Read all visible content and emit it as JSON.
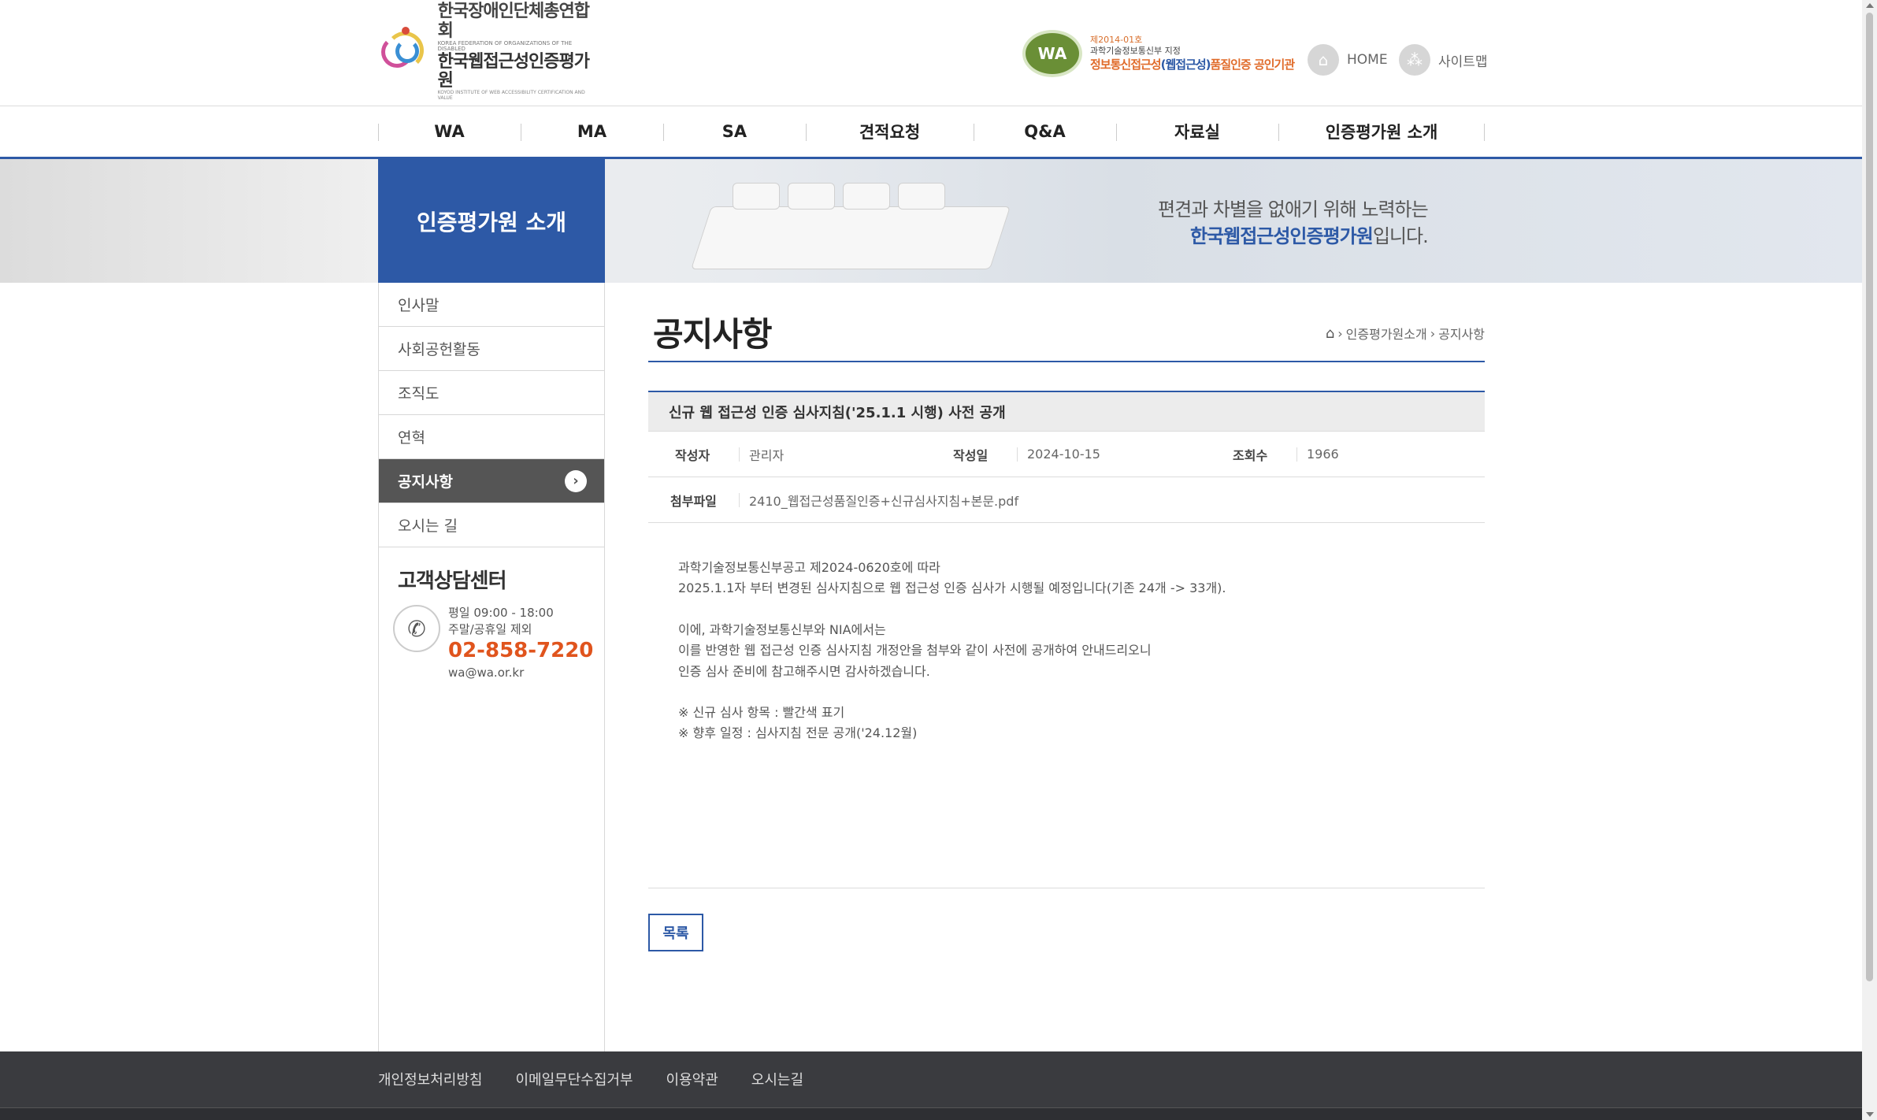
{
  "header": {
    "logo_line1": "한국장애인단체총연합회",
    "logo_line1_sub": "KOREA FEDERATION OF ORGANIZATIONS OF THE DISABLED",
    "logo_line2": "한국웹접근성인증평가원",
    "logo_line2_sub": "KOYOD INSTITUTE OF WEB ACCESSIBILITY CERTIFICATION AND VALUE",
    "cert_badge": "WA",
    "cert_no": "제2014-01호",
    "cert_line2": "과학기술정보통신부 지정",
    "cert_line3a": "정보통신접근성",
    "cert_line3b": "(웹접근성)",
    "cert_line3c": "품질인증 공인기관",
    "home_label": "HOME",
    "sitemap_label": "사이트맵"
  },
  "gnb": {
    "items": [
      "WA",
      "MA",
      "SA",
      "견적요청",
      "Q&A",
      "자료실",
      "인증평가원 소개"
    ]
  },
  "visual": {
    "section_title": "인증평가원 소개",
    "copy_line1": "편견과 차별을 없애기 위해 노력하는",
    "copy_line2_bold": "한국웹접근성인증평가원",
    "copy_line2_rest": "입니다."
  },
  "lnb": {
    "items": [
      "인사말",
      "사회공헌활동",
      "조직도",
      "연혁",
      "공지사항",
      "오시는 길"
    ],
    "active_index": 4,
    "cs_title": "고객상담센터",
    "cs_hours1": "평일 09:00 - 18:00",
    "cs_hours2": "주말/공휴일 제외",
    "cs_tel": "02-858-7220",
    "cs_email": "wa@wa.or.kr"
  },
  "content": {
    "page_title": "공지사항",
    "breadcrumb": [
      "인증평가원소개",
      "공지사항"
    ],
    "subject": "신규 웹 접근성 인증 심사지침('25.1.1 시행) 사전 공개",
    "writer_label": "작성자",
    "writer": "관리자",
    "date_label": "작성일",
    "date": "2024-10-15",
    "views_label": "조회수",
    "views": "1966",
    "file_label": "첨부파일",
    "file": "2410_웹접근성품질인증+신규심사지침+본문.pdf",
    "body": [
      "과학기술정보통신부공고 제2024-0620호에 따라",
      "2025.1.1자 부터 변경된 심사지침으로 웹 접근성 인증 심사가 시행될 예정입니다(기존 24개 -> 33개).",
      "",
      "이에, 과학기술정보통신부와 NIA에서는",
      "이를 반영한 웹 접근성 인증 심사지침 개정안을 첨부와 같이 사전에 공개하여 안내드리오니",
      "인증 심사 준비에 참고해주시면 감사하겠습니다.",
      "",
      "※ 신규 심사 항목 : 빨간색 표기",
      "※ 향후 일정 : 심사지침 전문 공개('24.12월)"
    ],
    "list_button": "목록"
  },
  "footer": {
    "links": [
      "개인정보처리방침",
      "이메일무단수집거부",
      "이용약관",
      "오시는길"
    ]
  },
  "colors": {
    "accent": "#2d59a6",
    "tel": "#e0541d",
    "footer_bg": "#3a3b3f"
  }
}
